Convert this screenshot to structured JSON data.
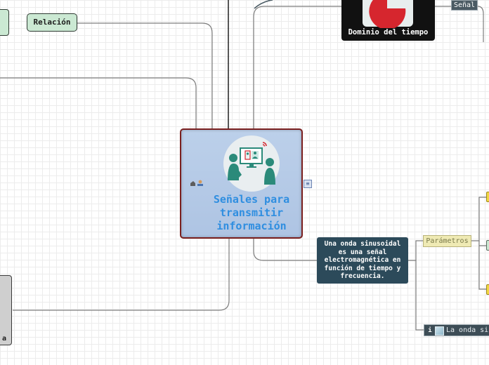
{
  "map": {
    "central": {
      "title_lines": [
        "Señales para",
        "transmitir",
        "información"
      ]
    },
    "nodes": {
      "relacion": "Relación",
      "dominio_tiempo": "Dominio del tiempo",
      "senal": "Señal",
      "onda_sinusoidal": [
        "Una onda sinusoidal",
        "es una señal",
        "electromagnética en",
        "función de tiempo y",
        "frecuencia."
      ],
      "parametros": "Parámetros",
      "la_onda": "La onda si",
      "left_gray_fragment": "a"
    }
  },
  "icons": {
    "central_image": "people-screen-icon",
    "attach_icons": "people-link-icon",
    "note": "note-icon",
    "dominio_image": "pie-chart-icon",
    "info": "info-icon",
    "image_thumb": "image-icon"
  },
  "colors": {
    "central_border": "#7a1f1f",
    "central_title": "#2f8ee0",
    "central_fill": "#b6cae6",
    "relacion_fill": "#cbe9d3",
    "onda_fill": "#2c4a5a",
    "dominio_fill": "#111111",
    "parametros_fill": "#efeab4",
    "yellow_node": "#f2d742",
    "pie_red": "#d6262e"
  }
}
